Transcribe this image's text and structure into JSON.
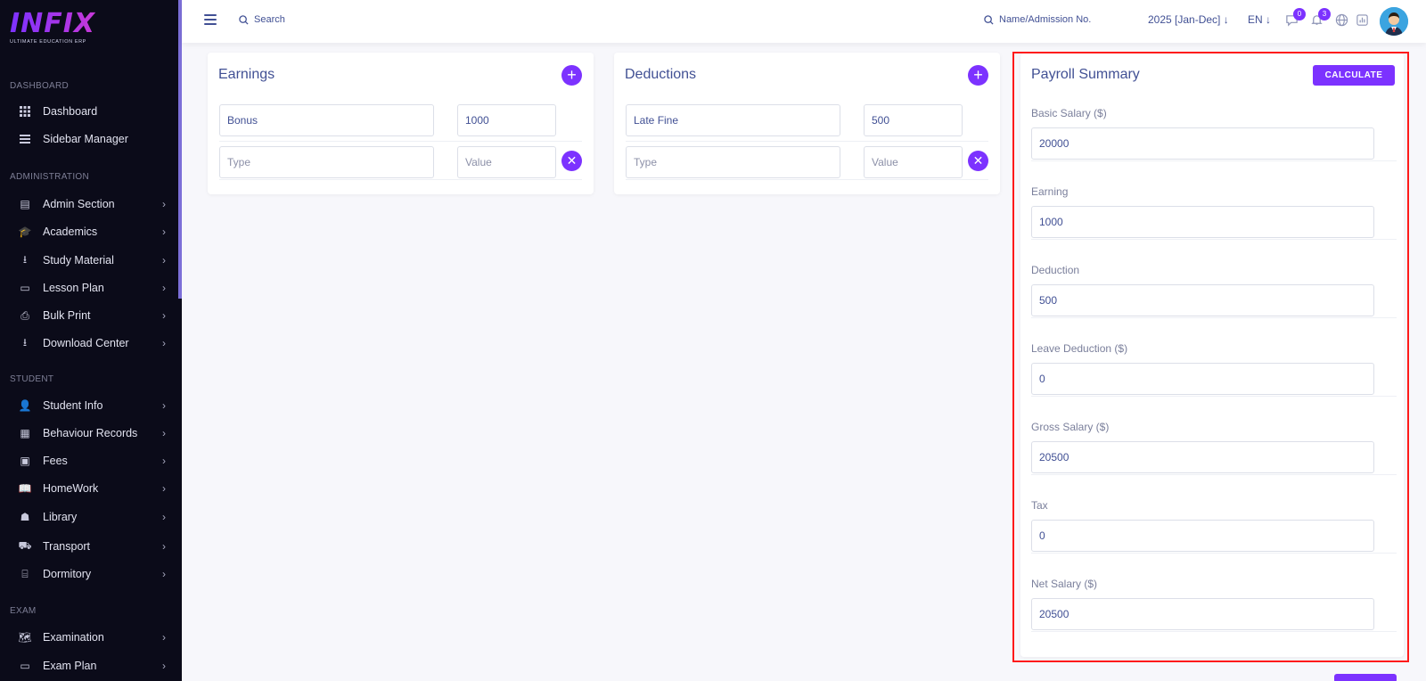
{
  "brand": {
    "logo": "INFIX",
    "tagline": "ULTIMATE EDUCATION ERP"
  },
  "sidebar": {
    "sections": [
      {
        "title": "DASHBOARD",
        "items": [
          {
            "label": "Dashboard",
            "icon": "grid-icon"
          },
          {
            "label": "Sidebar Manager",
            "icon": "bars-icon"
          }
        ]
      },
      {
        "title": "ADMINISTRATION",
        "items": [
          {
            "label": "Admin Section"
          },
          {
            "label": "Academics"
          },
          {
            "label": "Study Material"
          },
          {
            "label": "Lesson Plan"
          },
          {
            "label": "Bulk Print"
          },
          {
            "label": "Download Center"
          }
        ]
      },
      {
        "title": "STUDENT",
        "items": [
          {
            "label": "Student Info"
          },
          {
            "label": "Behaviour Records"
          },
          {
            "label": "Fees"
          },
          {
            "label": "HomeWork"
          },
          {
            "label": "Library"
          },
          {
            "label": "Transport"
          },
          {
            "label": "Dormitory"
          }
        ]
      },
      {
        "title": "EXAM",
        "items": [
          {
            "label": "Examination"
          },
          {
            "label": "Exam Plan"
          }
        ]
      }
    ]
  },
  "topbar": {
    "search_label": "Search",
    "name_search_label": "Name/Admission No.",
    "session": "2025 [Jan-Dec]",
    "language": "EN",
    "messages_count": "0",
    "notifications_count": "3"
  },
  "earnings": {
    "title": "Earnings",
    "rows": [
      {
        "type": "Bonus",
        "value": "1000"
      }
    ],
    "type_placeholder": "Type",
    "value_placeholder": "Value"
  },
  "deductions": {
    "title": "Deductions",
    "rows": [
      {
        "type": "Late Fine",
        "value": "500"
      }
    ],
    "type_placeholder": "Type",
    "value_placeholder": "Value"
  },
  "summary": {
    "title": "Payroll Summary",
    "calculate_label": "CALCULATE",
    "fields": [
      {
        "label": "Basic Salary ($)",
        "value": "20000"
      },
      {
        "label": "Earning",
        "value": "1000"
      },
      {
        "label": "Deduction",
        "value": "500"
      },
      {
        "label": "Leave Deduction ($)",
        "value": "0"
      },
      {
        "label": "Gross Salary ($)",
        "value": "20500"
      },
      {
        "label": "Tax",
        "value": "0"
      },
      {
        "label": "Net Salary ($)",
        "value": "20500"
      }
    ]
  },
  "colors": {
    "accent": "#7c32ff",
    "sidebar_bg": "#0b0b19",
    "text": "#415094",
    "highlight": "#ff1a1a"
  }
}
